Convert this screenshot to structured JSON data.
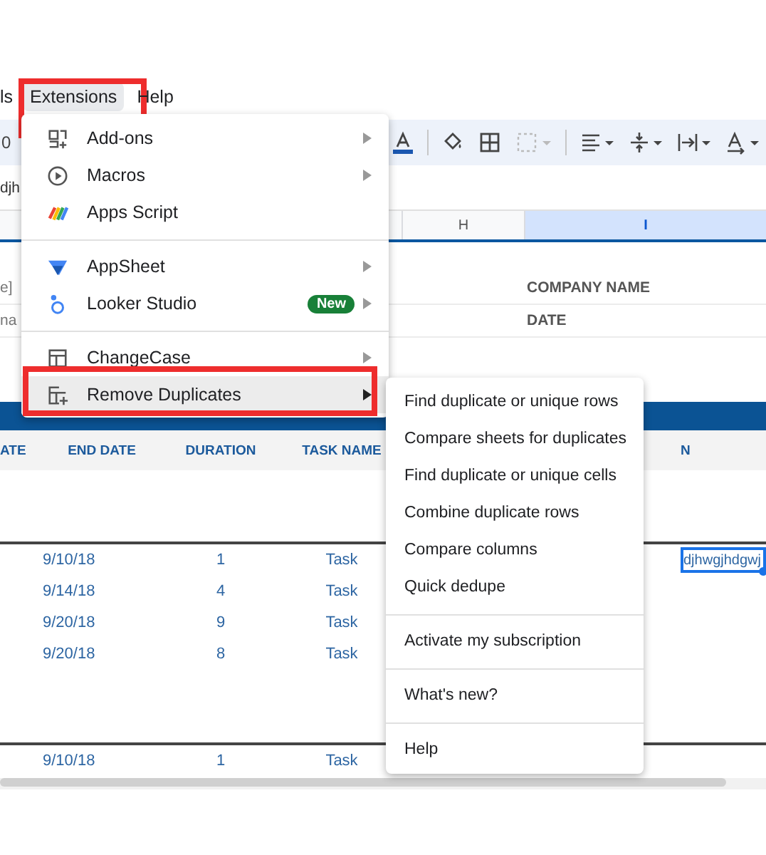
{
  "menu_bar": [
    {
      "label": "ls",
      "selected": false,
      "annotated": false
    },
    {
      "label": "Extensions",
      "selected": true,
      "annotated": true
    },
    {
      "label": "Help",
      "selected": false,
      "annotated": false
    }
  ],
  "toolbar": {
    "zoom_fragment": "0"
  },
  "formula_bar": {
    "value": "djh"
  },
  "column_headers": [
    {
      "label": "H",
      "selected": false
    },
    {
      "label": "I",
      "selected": true
    }
  ],
  "sheet": {
    "left_fragments": [
      "e]",
      "na"
    ],
    "info_labels": [
      "COMPANY NAME",
      "DATE"
    ],
    "table_columns": [
      "ATE",
      "END DATE",
      "DURATION",
      "TASK NAME",
      "N"
    ],
    "row_groups": [
      [
        {
          "end_date": "9/10/18",
          "duration": "1",
          "task_name": "Task",
          "active_cell": "djhwgjhdgwj"
        },
        {
          "end_date": "9/14/18",
          "duration": "4",
          "task_name": "Task"
        },
        {
          "end_date": "9/20/18",
          "duration": "9",
          "task_name": "Task"
        },
        {
          "end_date": "9/20/18",
          "duration": "8",
          "task_name": "Task"
        }
      ],
      [
        {
          "end_date": "9/10/18",
          "duration": "1",
          "task_name": "Task"
        }
      ]
    ]
  },
  "extensions_menu": {
    "sections": [
      [
        {
          "label": "Add-ons",
          "submenu": true,
          "selected": false,
          "annotated": false
        },
        {
          "label": "Macros",
          "submenu": true,
          "selected": false,
          "annotated": false
        },
        {
          "label": "Apps Script",
          "submenu": false,
          "selected": false,
          "annotated": false
        }
      ],
      [
        {
          "label": "AppSheet",
          "submenu": true,
          "selected": false,
          "annotated": false
        },
        {
          "label": "Looker Studio",
          "submenu": true,
          "selected": false,
          "annotated": false,
          "badge": "New"
        }
      ],
      [
        {
          "label": "ChangeCase",
          "submenu": true,
          "selected": false,
          "annotated": false
        },
        {
          "label": "Remove Duplicates",
          "submenu": true,
          "selected": true,
          "annotated": true
        }
      ]
    ]
  },
  "remove_duplicates_submenu": {
    "sections": [
      [
        "Find duplicate or unique rows",
        "Compare sheets for duplicates",
        "Find duplicate or unique cells",
        "Combine duplicate rows",
        "Compare columns",
        "Quick dedupe"
      ],
      [
        "Activate my subscription"
      ],
      [
        "What's new?"
      ],
      [
        "Help"
      ]
    ]
  }
}
